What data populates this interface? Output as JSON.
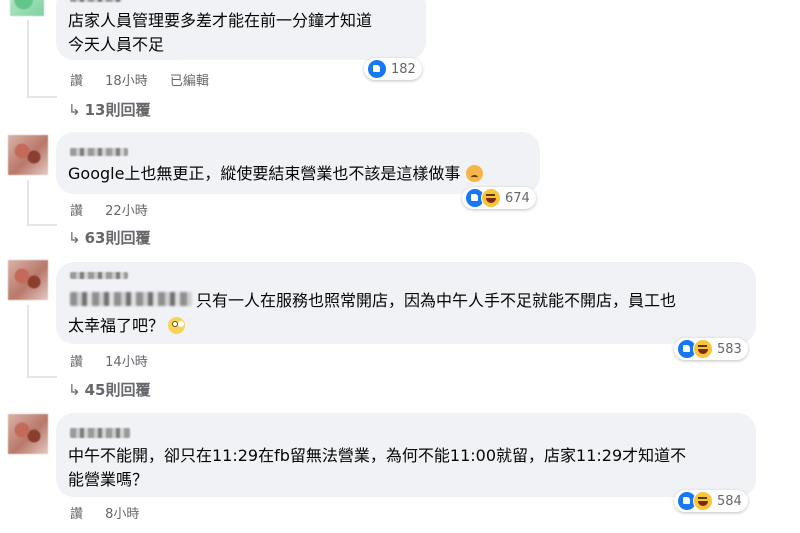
{
  "comments": [
    {
      "lines": [
        "店家人員管理要多差才能在前一分鐘才知道",
        "今天人員不足"
      ],
      "meta": [
        "讚",
        "18小時",
        "已編輯"
      ],
      "reaction_count": "182",
      "replies": "13則回覆"
    },
    {
      "lines": [
        "Google上也無更正，縱使要結束營業也不該是這樣做事"
      ],
      "meta": [
        "讚",
        "22小時"
      ],
      "reaction_count": "674",
      "replies": "63則回覆"
    },
    {
      "lines": [
        "只有一人在服務也照常開店，因為中午人手不足就能不開店，員工也",
        "太幸福了吧？"
      ],
      "meta": [
        "讚",
        "14小時"
      ],
      "reaction_count": "583",
      "replies": "45則回覆"
    },
    {
      "lines": [
        "中午不能開，卻只在11:29在fb留無法營業，為何不能11:00就留，店家11:29才知道不",
        "能營業嗎？"
      ],
      "meta": [
        "讚",
        "8小時"
      ],
      "reaction_count": "584"
    }
  ],
  "icons": {
    "like": "like-reaction-icon",
    "haha": "haha-reaction-icon",
    "reply_arrow": "reply-arrow-icon"
  },
  "colors": {
    "bubble": "#f0f2f5",
    "meta_text": "#65676b",
    "like_blue": "#1877f2"
  }
}
